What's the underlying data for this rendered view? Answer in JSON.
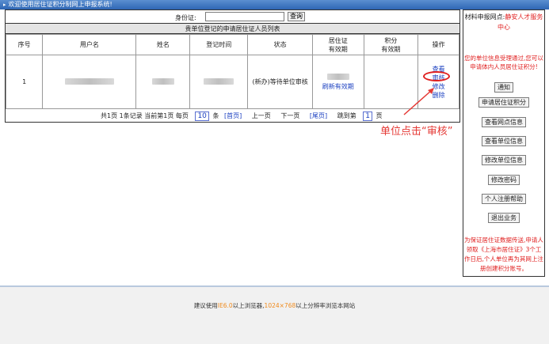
{
  "topbar": {
    "marker": "▸",
    "text": "欢迎使用居住证积分制网上申报系统!"
  },
  "search": {
    "label": "身份证:",
    "value": "",
    "button": "查询"
  },
  "list_caption": "贵单位登记的申请居住证人员列表",
  "table": {
    "headers": [
      "序号",
      "用户名",
      "姓名",
      "登记时间",
      "状态",
      "居住证\n有效期",
      "积分\n有效期",
      "操作"
    ],
    "rows": [
      {
        "index": "1",
        "status": "(新办)等待单位审核",
        "permit_link": "刷新有效期",
        "score_valid": ""
      }
    ],
    "ops": [
      "查看",
      "审核",
      "修改",
      "删除"
    ]
  },
  "pager": {
    "summary": "共1页 1条记录 当前第1页 每页",
    "page_size": "10",
    "unit": "条",
    "first": "[首页]",
    "prev": "上一页",
    "next": "下一页",
    "last": "[尾页]",
    "goto_label": "跳到第",
    "goto_value": "1",
    "goto_unit": "页"
  },
  "annotation": {
    "text": "单位点击“审核”",
    "color": "#e53935"
  },
  "sidebar": {
    "note_top_prefix": "材料申报网点:",
    "note_top_red": "静安人才服务中心",
    "note_mid": "您的单位信息受理通过,您可以申请体内人员居住证积分!",
    "buttons": [
      "通知",
      "申请居住证积分",
      "查看网点信息",
      "查看单位信息",
      "修改单位信息",
      "修改密码",
      "个人注册帮助",
      "退出业务"
    ],
    "note_bottom": "为保证居住证数据传送,申请人领取《上海市居住证》3个工作日后,个人单位再为其网上注册创建积分账号。"
  },
  "footer": {
    "prefix": "建议使用",
    "browser": "IE6.0",
    "mid": "以上浏览器,",
    "resolution": "1024×768",
    "suffix": "以上分辨率浏览本网站"
  }
}
